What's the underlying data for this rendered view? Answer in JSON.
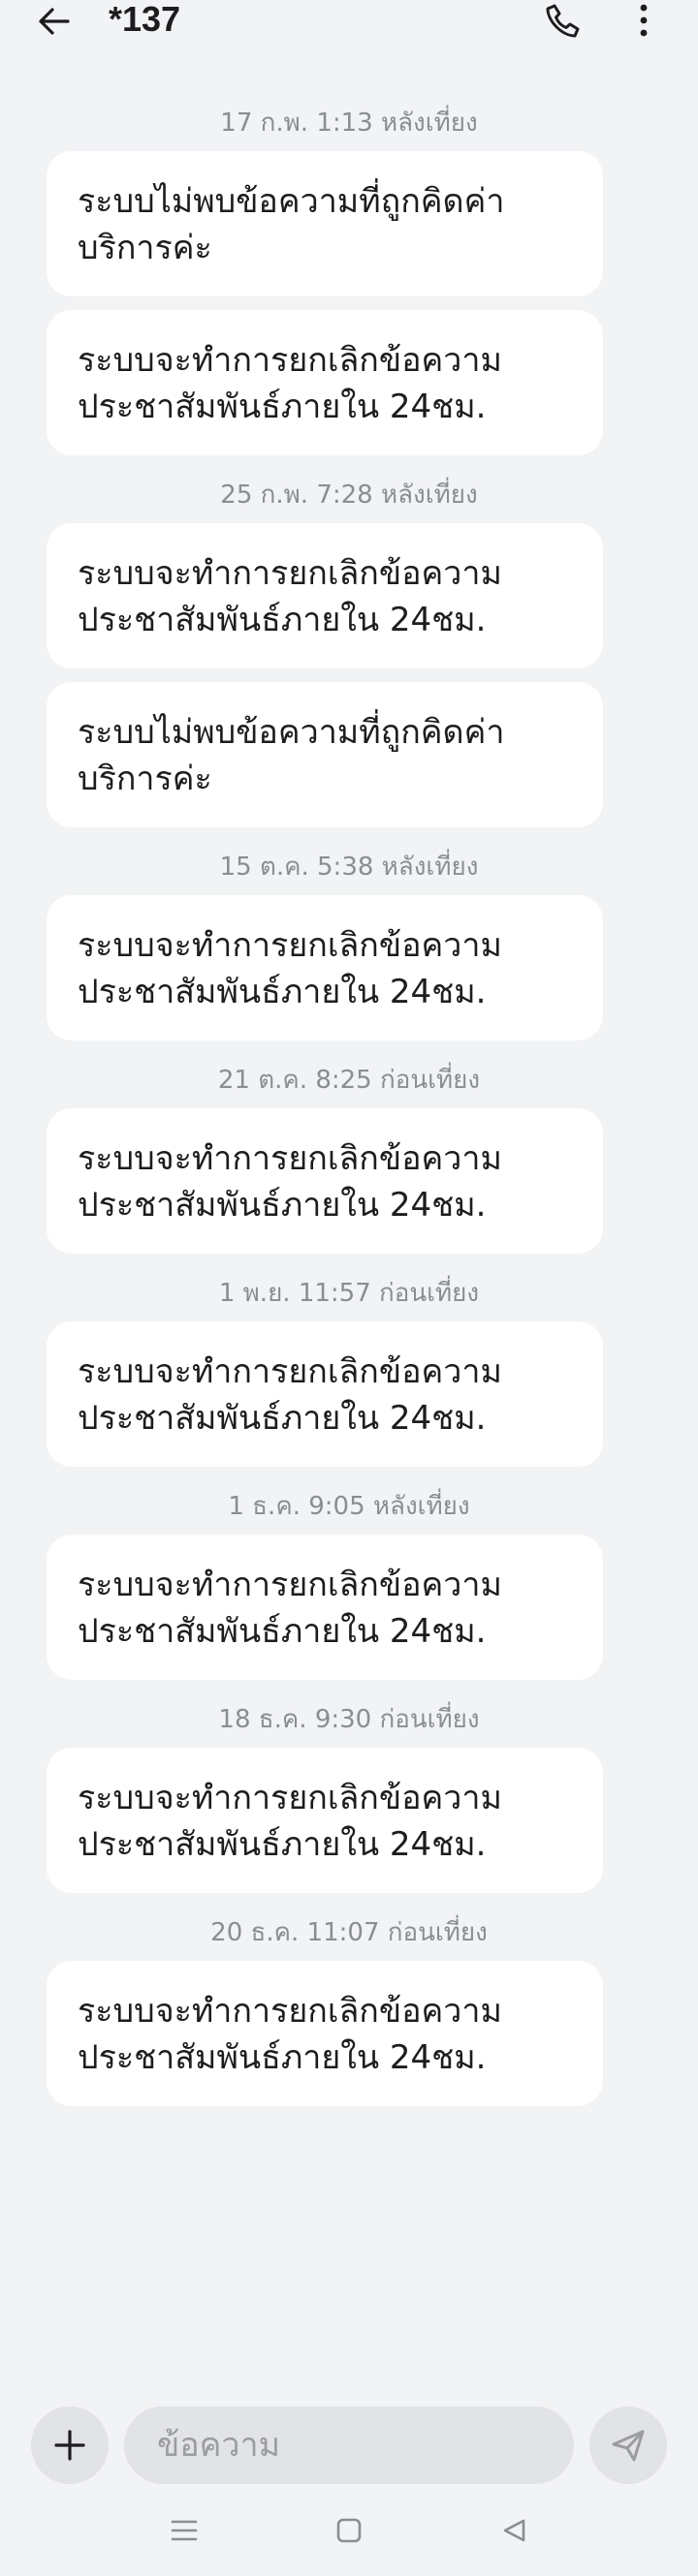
{
  "header": {
    "title": "*137"
  },
  "thread": [
    {
      "date": "17 ก.พ. 1:13 หลังเที่ยง",
      "messages": [
        "ระบบไม่พบข้อความที่ถูกคิดค่าบริการค่ะ",
        "ระบบจะทำการยกเลิกข้อความประชาสัมพันธ์ภายใน 24ชม."
      ]
    },
    {
      "date": "25 ก.พ. 7:28 หลังเที่ยง",
      "messages": [
        "ระบบจะทำการยกเลิกข้อความประชาสัมพันธ์ภายใน 24ชม.",
        "ระบบไม่พบข้อความที่ถูกคิดค่าบริการค่ะ"
      ]
    },
    {
      "date": "15 ต.ค. 5:38 หลังเที่ยง",
      "messages": [
        "ระบบจะทำการยกเลิกข้อความประชาสัมพันธ์ภายใน 24ชม."
      ]
    },
    {
      "date": "21 ต.ค. 8:25 ก่อนเที่ยง",
      "messages": [
        "ระบบจะทำการยกเลิกข้อความประชาสัมพันธ์ภายใน 24ชม."
      ]
    },
    {
      "date": "1 พ.ย. 11:57 ก่อนเที่ยง",
      "messages": [
        "ระบบจะทำการยกเลิกข้อความประชาสัมพันธ์ภายใน 24ชม."
      ]
    },
    {
      "date": "1 ธ.ค. 9:05 หลังเที่ยง",
      "messages": [
        "ระบบจะทำการยกเลิกข้อความประชาสัมพันธ์ภายใน 24ชม."
      ]
    },
    {
      "date": "18 ธ.ค. 9:30 ก่อนเที่ยง",
      "messages": [
        "ระบบจะทำการยกเลิกข้อความประชาสัมพันธ์ภายใน 24ชม."
      ]
    },
    {
      "date": "20 ธ.ค. 11:07 ก่อนเที่ยง",
      "messages": [
        "ระบบจะทำการยกเลิกข้อความประชาสัมพันธ์ภายใน 24ชม."
      ]
    }
  ],
  "composer": {
    "placeholder": "ข้อความ"
  },
  "icons": {
    "back": "back-arrow-icon",
    "call": "phone-icon",
    "more": "more-vert-icon",
    "plus": "plus-icon",
    "send": "send-icon",
    "nav_menu": "menu-icon",
    "nav_home": "home-square-icon",
    "nav_back": "back-triangle-icon"
  }
}
